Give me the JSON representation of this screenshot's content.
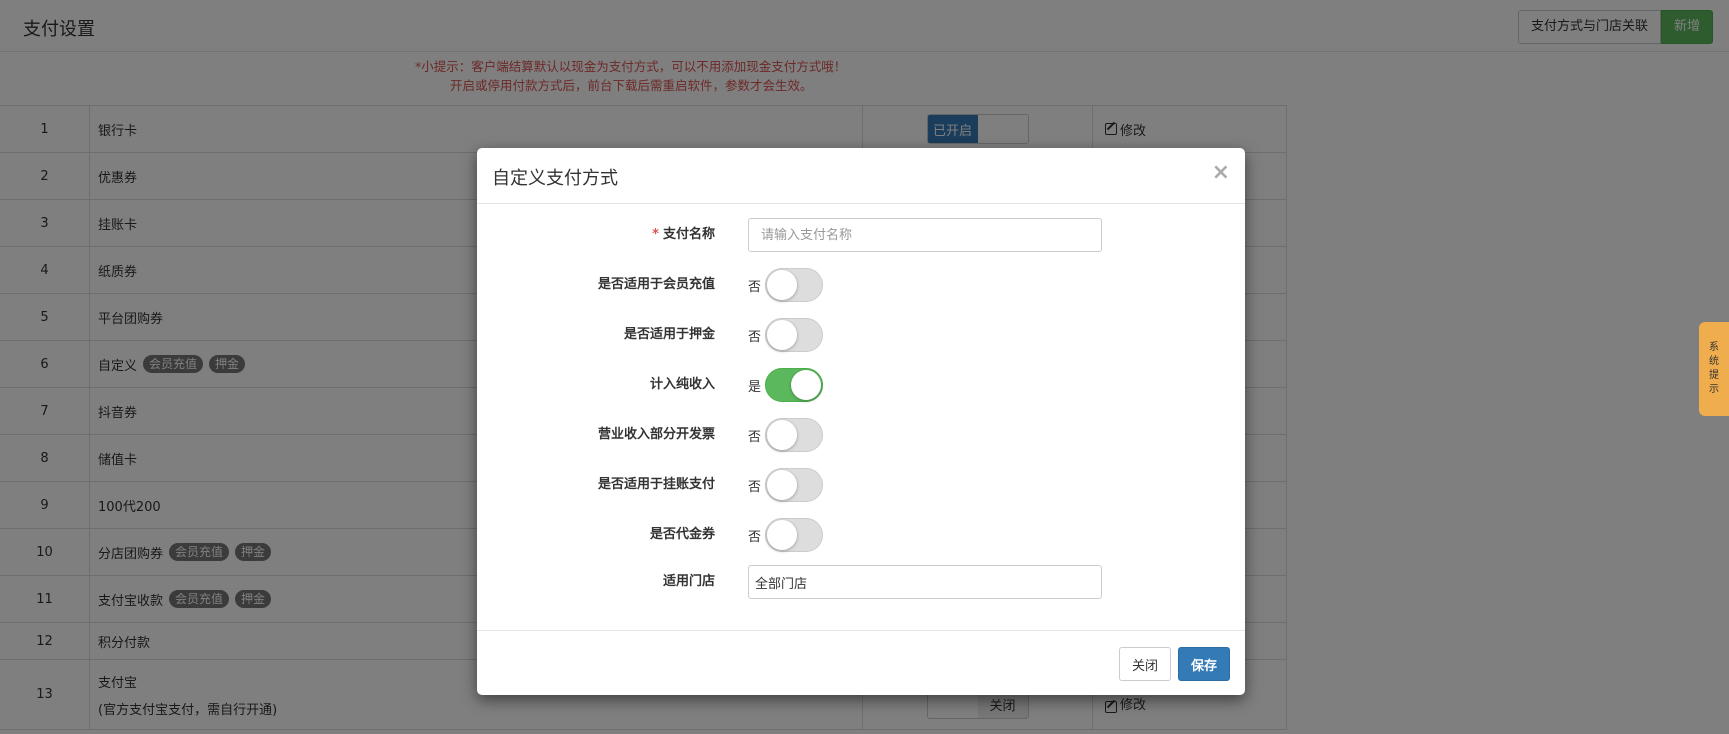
{
  "header": {
    "title": "支付设置",
    "assoc_button": "支付方式与门店关联",
    "new_button": "新增"
  },
  "tip": {
    "line1": "*小提示：客户端结算默认以现金为支付方式，可以不用添加现金支付方式哦！",
    "line2": "开启或停用付款方式后，前台下载后需重启软件，参数才会生效。"
  },
  "table": {
    "rows": [
      {
        "no": "1",
        "name": "银行卡",
        "badges": [],
        "status_on": "已开启",
        "edit": "修改"
      },
      {
        "no": "2",
        "name": "优惠券",
        "badges": []
      },
      {
        "no": "3",
        "name": "挂账卡",
        "badges": []
      },
      {
        "no": "4",
        "name": "纸质券",
        "badges": []
      },
      {
        "no": "5",
        "name": "平台团购券",
        "badges": []
      },
      {
        "no": "6",
        "name": "自定义",
        "badges": [
          "会员充值",
          "押金"
        ]
      },
      {
        "no": "7",
        "name": "抖音券",
        "badges": []
      },
      {
        "no": "8",
        "name": "储值卡",
        "badges": []
      },
      {
        "no": "9",
        "name": "100代200",
        "badges": []
      },
      {
        "no": "10",
        "name": "分店团购券",
        "badges": [
          "会员充值",
          "押金"
        ]
      },
      {
        "no": "11",
        "name": "支付宝收款",
        "badges": [
          "会员充值",
          "押金"
        ]
      },
      {
        "no": "12",
        "name": "积分付款",
        "badges": []
      },
      {
        "no": "13",
        "name": "支付宝",
        "sub": "(官方支付宝支付，需自行开通)",
        "badges": [],
        "status_off": "关闭",
        "edit": "修改"
      }
    ]
  },
  "side_tab": {
    "label": [
      "系",
      "统",
      "提",
      "示"
    ]
  },
  "modal": {
    "title": "自定义支付方式",
    "close_icon": "×",
    "fields": {
      "name_label": "支付名称",
      "name_required": "*",
      "name_placeholder": "请输入支付名称",
      "recharge_label": "是否适用于会员充值",
      "recharge_value": "否",
      "deposit_label": "是否适用于押金",
      "deposit_value": "否",
      "net_income_label": "计入纯收入",
      "net_income_value": "是",
      "invoice_label": "营业收入部分开发票",
      "invoice_value": "否",
      "credit_label": "是否适用于挂账支付",
      "credit_value": "否",
      "voucher_label": "是否代金券",
      "voucher_value": "否",
      "store_label": "适用门店",
      "store_value": "全部门店"
    },
    "footer": {
      "close_button": "关闭",
      "save_button": "保存"
    }
  }
}
